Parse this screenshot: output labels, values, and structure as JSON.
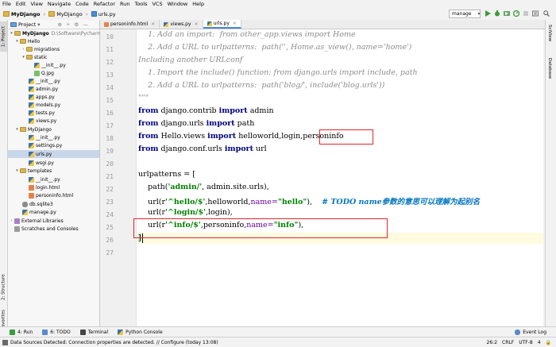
{
  "menu": [
    "File",
    "Edit",
    "View",
    "Navigate",
    "Code",
    "Refactor",
    "Run",
    "Tools",
    "VCS",
    "Window",
    "Help"
  ],
  "breadcrumbs": [
    "MyDjango",
    "MyDjango",
    "urls.py"
  ],
  "run_config": "manage",
  "left_tools": {
    "project": "1: Project",
    "structure": "2: Structure",
    "favorites": "2: Favorites"
  },
  "right_tools": {
    "sciview": "SciView",
    "database": "Database"
  },
  "project_panel": {
    "title": "Project",
    "tree": [
      {
        "label": "MyDjango",
        "extra": "D:\\Software\\Pycharm\\"
      },
      {
        "label": "Hello"
      },
      {
        "label": "migrations"
      },
      {
        "label": "static"
      },
      {
        "label": "__init__.py"
      },
      {
        "label": "Q.jpg"
      },
      {
        "label": "__init__.py"
      },
      {
        "label": "admin.py"
      },
      {
        "label": "apps.py"
      },
      {
        "label": "models.py"
      },
      {
        "label": "tests.py"
      },
      {
        "label": "views.py"
      },
      {
        "label": "MyDjango"
      },
      {
        "label": "__init__.py"
      },
      {
        "label": "settings.py"
      },
      {
        "label": "urls.py"
      },
      {
        "label": "wsgi.py"
      },
      {
        "label": "templates"
      },
      {
        "label": "__init__.py"
      },
      {
        "label": "login.html"
      },
      {
        "label": "personinfo.html"
      },
      {
        "label": "db.sqlite3"
      },
      {
        "label": "manage.py"
      },
      {
        "label": "External Libraries"
      },
      {
        "label": "Scratches and Consoles"
      }
    ]
  },
  "tabs": [
    "personinfo.html",
    "views.py",
    "urls.py"
  ],
  "editor": {
    "line_numbers": [
      "10",
      "11",
      "12",
      "13",
      "14",
      "15",
      "16",
      "17",
      "18",
      "19",
      "20",
      "21",
      "22",
      "23",
      "24",
      "25",
      "26",
      "27"
    ],
    "lines": {
      "c1": "    1. Add an import:  from other_app.views import Home",
      "c2": "    2. Add a URL to urlpatterns:  path('', Home.as_view(), name='home')",
      "c3": "Including another URLconf",
      "c4": "    1. Import the include() function: from django.urls import include, path",
      "c5": "    2. Add a URL to urlpatterns:  path('blog/', include('blog.urls'))",
      "c6": "\"\"\"",
      "from": "from",
      "import": "import",
      "m1": " django.contrib ",
      "m1b": " admin",
      "m2": " django.urls ",
      "m2b": " path",
      "m3": " Hello.views ",
      "m3b": " helloworld,login,",
      "m3c": "personinfo",
      "m4": " django.conf.urls ",
      "m4b": " url",
      "up": "urlpatterns = [",
      "p1a": "    path(",
      "p1b": "'admin/'",
      "p1c": ", admin.site.urls),",
      "u1a": "    url(r",
      "u1b": "'^hello/$'",
      "u1c": ",helloworld,",
      "u1d": "name=",
      "u1e": "\"hello\"",
      "u1f": "),    ",
      "u1g": "# TODO name参数的意思可以理解为起别名",
      "u2a": "    url(r",
      "u2b": "'^login/$'",
      "u2c": ",login),",
      "u3a": "    url(r",
      "u3b": "'^info/$'",
      "u3c": ",personinfo,",
      "u3d": "name=",
      "u3e": "\"info\"",
      "u3f": "),",
      "close": "]"
    }
  },
  "tool_windows": [
    "4: Run",
    "6: TODO",
    "Terminal",
    "Python Console"
  ],
  "event_log": "Event Log",
  "status": {
    "message": "Data Sources Detected: Connection properties are detected. // Configure (today 13:08)",
    "position": "26:2",
    "line_sep": "CRLF",
    "encoding": "UTF-8",
    "indent": "4"
  },
  "colors": {
    "accent": "#4a88d6",
    "highlight_box": "#e0282c"
  }
}
